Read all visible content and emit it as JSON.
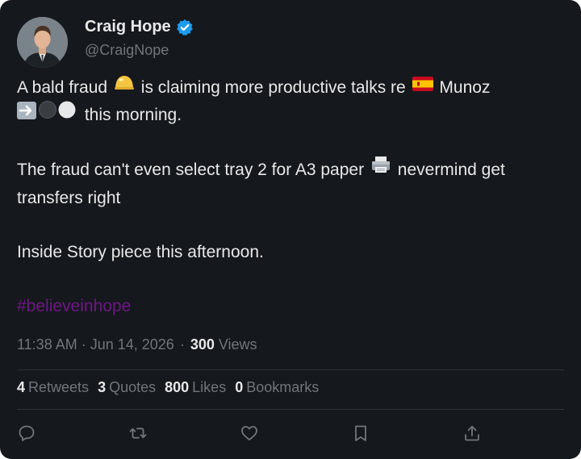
{
  "author": {
    "name": "Craig Hope",
    "handle": "@CraigNope",
    "verified": true,
    "avatar_icon": "profile-photo"
  },
  "tweet": {
    "line1_a": "A bald fraud",
    "line1_b": "is claiming more productive talks re",
    "line1_c": "Munoz",
    "line2_b": "this morning.",
    "para2_a": "The fraud can't even select tray 2 for A3 paper",
    "para2_b": "nevermind get",
    "para2_c": "transfers right",
    "para3": "Inside Story piece this afternoon.",
    "hashtag": "#believeinhope",
    "emoji_icons": [
      "bald-head-emoji",
      "spain-flag-emoji",
      "right-arrow-emoji",
      "black-circle-emoji",
      "white-circle-emoji",
      "printer-emoji"
    ]
  },
  "meta": {
    "time": "11:38 AM",
    "separator": "·",
    "date": "Jun 14, 2026",
    "dot": "·",
    "views_count": "300",
    "views_label": "Views"
  },
  "stats": {
    "retweets_count": "4",
    "retweets_label": "Retweets",
    "quotes_count": "3",
    "quotes_label": "Quotes",
    "likes_count": "800",
    "likes_label": "Likes",
    "bookmarks_count": "0",
    "bookmarks_label": "Bookmarks"
  },
  "actions": [
    "reply-icon",
    "retweet-icon",
    "like-icon",
    "bookmark-icon",
    "share-icon"
  ],
  "colors": {
    "background": "#15181c",
    "text": "#e7e9ea",
    "secondary": "#71767b",
    "hashtag": "#6e1786",
    "verified": "#1d9bf0",
    "divider": "#2f3336"
  }
}
